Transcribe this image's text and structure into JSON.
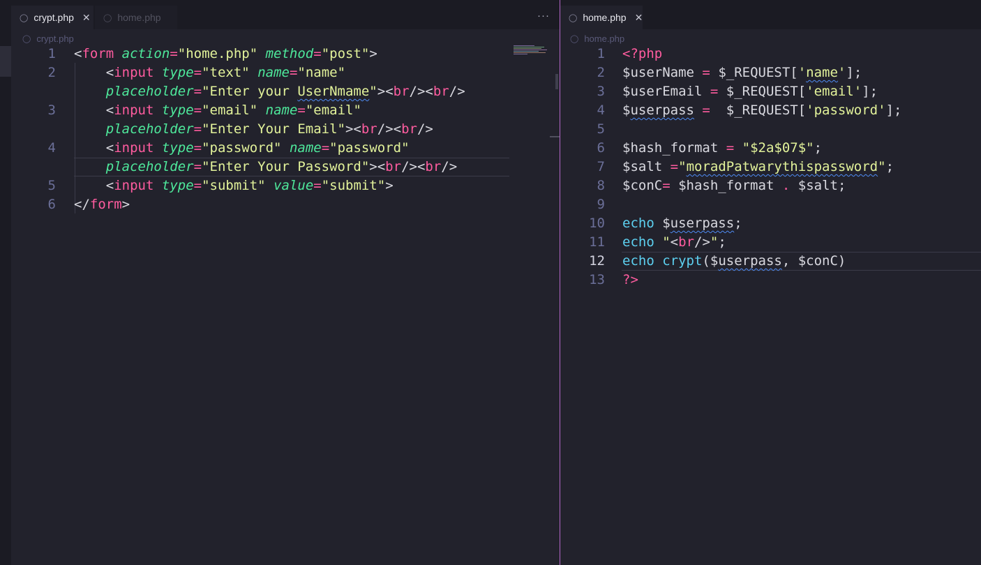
{
  "left": {
    "tabs": [
      {
        "label": "crypt.php",
        "active": true,
        "close": "✕"
      },
      {
        "label": "home.php",
        "active": false
      }
    ],
    "more_label": "···",
    "breadcrumb": "crypt.php",
    "line_numbers": [
      "1",
      "2",
      "3",
      "4",
      "5",
      "6"
    ],
    "current_line": "4"
  },
  "right": {
    "tabs": [
      {
        "label": "home.php",
        "active": true,
        "close": "✕"
      }
    ],
    "breadcrumb": "home.php",
    "line_numbers": [
      "1",
      "2",
      "3",
      "4",
      "5",
      "6",
      "7",
      "8",
      "9",
      "10",
      "11",
      "12",
      "13"
    ],
    "current_line": "12"
  },
  "icons": {
    "tab_file_icon": "php-elephant-icon",
    "close_icon": "close-icon",
    "more_icon": "ellipsis-icon"
  },
  "colors": {
    "background": "#22222c",
    "tag": "#ff5c9f",
    "attribute": "#4ee89b",
    "string": "#e2f29a",
    "function": "#5dd0f0",
    "line_number": "#6b6f98",
    "split_border": "#b467c8"
  }
}
